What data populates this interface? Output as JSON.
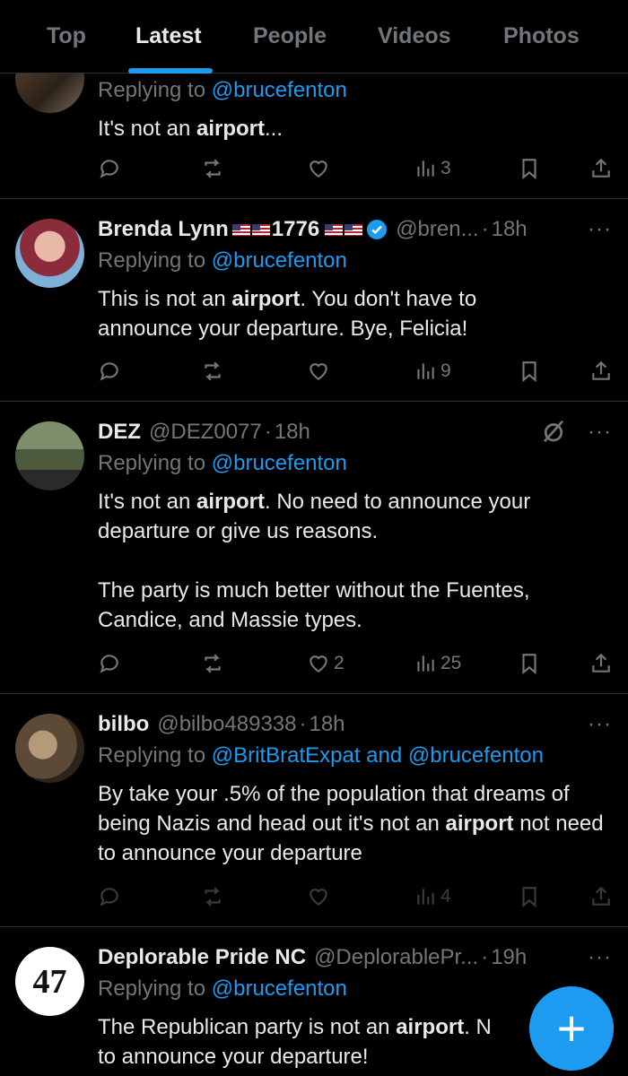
{
  "tabs": [
    {
      "label": "Top"
    },
    {
      "label": "Latest"
    },
    {
      "label": "People"
    },
    {
      "label": "Videos"
    },
    {
      "label": "Photos"
    }
  ],
  "active_tab": "Latest",
  "accent": "#1d9bf0",
  "posts": [
    {
      "replying_prefix": "Replying to",
      "replying_to": "@brucefenton",
      "text_pre": "It's not an ",
      "text_bold": "airport",
      "text_post": "...",
      "views": "3"
    },
    {
      "name": "Brenda Lynn",
      "name_suffix": "1776",
      "handle": "@bren...",
      "dot": "·",
      "time": "18h",
      "replying_prefix": "Replying to",
      "replying_to": "@brucefenton",
      "text_pre": "This is not an ",
      "text_bold": "airport",
      "text_post": ". You don't have to announce your departure. Bye, Felicia!",
      "views": "9"
    },
    {
      "name": "DEZ",
      "handle": "@DEZ0077",
      "dot": "·",
      "time": "18h",
      "replying_prefix": "Replying to",
      "replying_to": "@brucefenton",
      "text_pre": "It's not an ",
      "text_bold": "airport",
      "text_post": ". No need to announce your departure or give us reasons.",
      "text_para2": "The party is much better without the Fuentes, Candice, and Massie types.",
      "likes": "2",
      "views": "25"
    },
    {
      "name": "bilbo",
      "handle": "@bilbo489338",
      "dot": "·",
      "time": "18h",
      "replying_prefix": "Replying to",
      "replying_to": "@BritBratExpat and @brucefenton",
      "text_pre": "By take your .5% of the population that dreams of being Nazis and head out it's not an ",
      "text_bold": "airport",
      "text_post": " not need to announce your departure",
      "views": "4"
    },
    {
      "name": "Deplorable Pride NC",
      "handle": "@DeplorablePr...",
      "dot": "·",
      "time": "19h",
      "avatar_text": "47",
      "replying_prefix": "Replying to",
      "replying_to": "@brucefenton",
      "text_pre": "The Republican party is not an ",
      "text_bold": "airport",
      "text_post": ". N",
      "text_line2": "to announce your departure!"
    }
  ],
  "more_label": "···",
  "fab_label": "+"
}
